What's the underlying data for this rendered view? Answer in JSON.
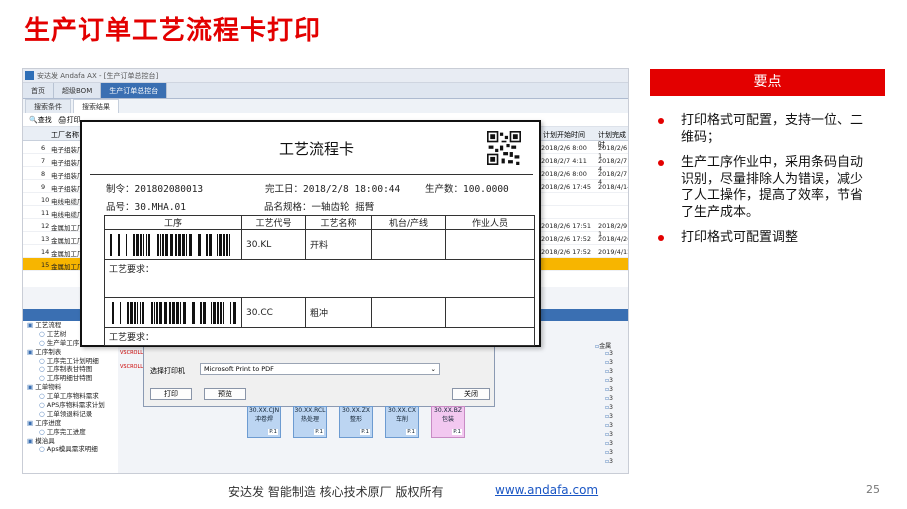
{
  "slide": {
    "title": "生产订单工艺流程卡打印",
    "points_header": "要点",
    "points": [
      "打印格式可配置，支持一位、二维码；",
      "生产工序作业中，采用条码自动识别，尽量排除人为错误，减少了人工操作，提高了效率，节省了生产成本。",
      "打印格式可配置调整"
    ],
    "footer_text": "安达发  智能制造 核心技术原厂  版权所有",
    "footer_link": "www.andafa.com",
    "page_number": "25"
  },
  "app": {
    "window_title": "安达发 Andafa AX - [生产订单总控台]",
    "main_tabs": [
      "首页",
      "超级BOM",
      "生产订单总控台"
    ],
    "sub_tabs": [
      "搜索条件",
      "搜索结果"
    ],
    "toolbar": [
      "查找",
      "打印"
    ],
    "grid": {
      "col_factory": "工厂名称",
      "col_plan_start": "计划开始时间",
      "col_plan_end": "计划完成时",
      "rows": [
        {
          "no": "6",
          "name": "电子组装厂",
          "start": "2018/2/6 8:00",
          "end": "2018/2/6 1"
        },
        {
          "no": "7",
          "name": "电子组装厂",
          "start": "2018/2/7 4:11",
          "end": "2018/2/7 4"
        },
        {
          "no": "8",
          "name": "电子组装厂",
          "start": "2018/2/6 8:00",
          "end": "2018/2/7 4"
        },
        {
          "no": "9",
          "name": "电子组装厂",
          "start": "2018/2/6 17:45",
          "end": "2018/4/14"
        },
        {
          "no": "10",
          "name": "电线电缆厂",
          "start": "",
          "end": ""
        },
        {
          "no": "11",
          "name": "电线电缆厂",
          "start": "",
          "end": ""
        },
        {
          "no": "12",
          "name": "金属加工厂",
          "start": "2018/2/6 17:51",
          "end": "2018/2/9 1"
        },
        {
          "no": "13",
          "name": "金属加工厂",
          "start": "2018/2/6 17:52",
          "end": "2018/4/26"
        },
        {
          "no": "14",
          "name": "金属加工厂",
          "start": "2018/2/6 17:52",
          "end": "2019/4/12"
        },
        {
          "no": "15",
          "name": "金属加工厂",
          "start": "",
          "end": ""
        }
      ]
    },
    "tree": [
      "工艺流程",
      "工艺树",
      "生产单工序",
      "工序制表",
      "工序完工计划明细",
      "工序制表甘特图",
      "工序明细甘特图",
      "工单物料",
      "工单工序物料需求",
      "APS序物料需求计划",
      "工单领退料记录",
      "工序进度",
      "工序完工进度",
      "模治具",
      "Aps模具需求明细"
    ],
    "right_tree": [
      "金属",
      "3",
      "3",
      "3",
      "3",
      "3",
      "3",
      "3",
      "3",
      "3",
      "3",
      "3",
      "3",
      "3"
    ],
    "dialog": {
      "printer_label": "选择打印机",
      "printer_value": "Microsoft Print to PDF",
      "print_btn": "打印",
      "preview_btn": "预览",
      "close_btn": "关闭",
      "side_label_1": "VSCROLL",
      "side_label_2": "VSCROLL"
    },
    "flow_nodes": [
      {
        "code": "30.XX.CJN",
        "name": "冲卷焊",
        "page": "P.1"
      },
      {
        "code": "30.XX.RCL",
        "name": "热处理",
        "page": "P.1"
      },
      {
        "code": "30.XX.ZX",
        "name": "整形",
        "page": "P.1"
      },
      {
        "code": "30.XX.CX",
        "name": "车削",
        "page": "P.1"
      },
      {
        "code": "30.XX.BZ",
        "name": "包装",
        "page": "P.1"
      }
    ]
  },
  "card": {
    "title": "工艺流程卡",
    "order_no": "制令：201802080013",
    "finish_time": "完工日：2018/2/8 18:00:44",
    "qty": "生产数：100.0000",
    "part_no": "品号：30.MHA.01",
    "spec": "品名规格：一轴齿轮  摇臂",
    "headers": [
      "工序",
      "工艺代号",
      "工艺名称",
      "机台/产线",
      "作业人员"
    ],
    "rows": [
      {
        "code": "30.KL",
        "name": "开料"
      },
      {
        "code": "30.CC",
        "name": "粗冲"
      }
    ],
    "req_label": "工艺要求：",
    "colors": {
      "accent": "#e30000",
      "link": "#1a56c4"
    }
  }
}
